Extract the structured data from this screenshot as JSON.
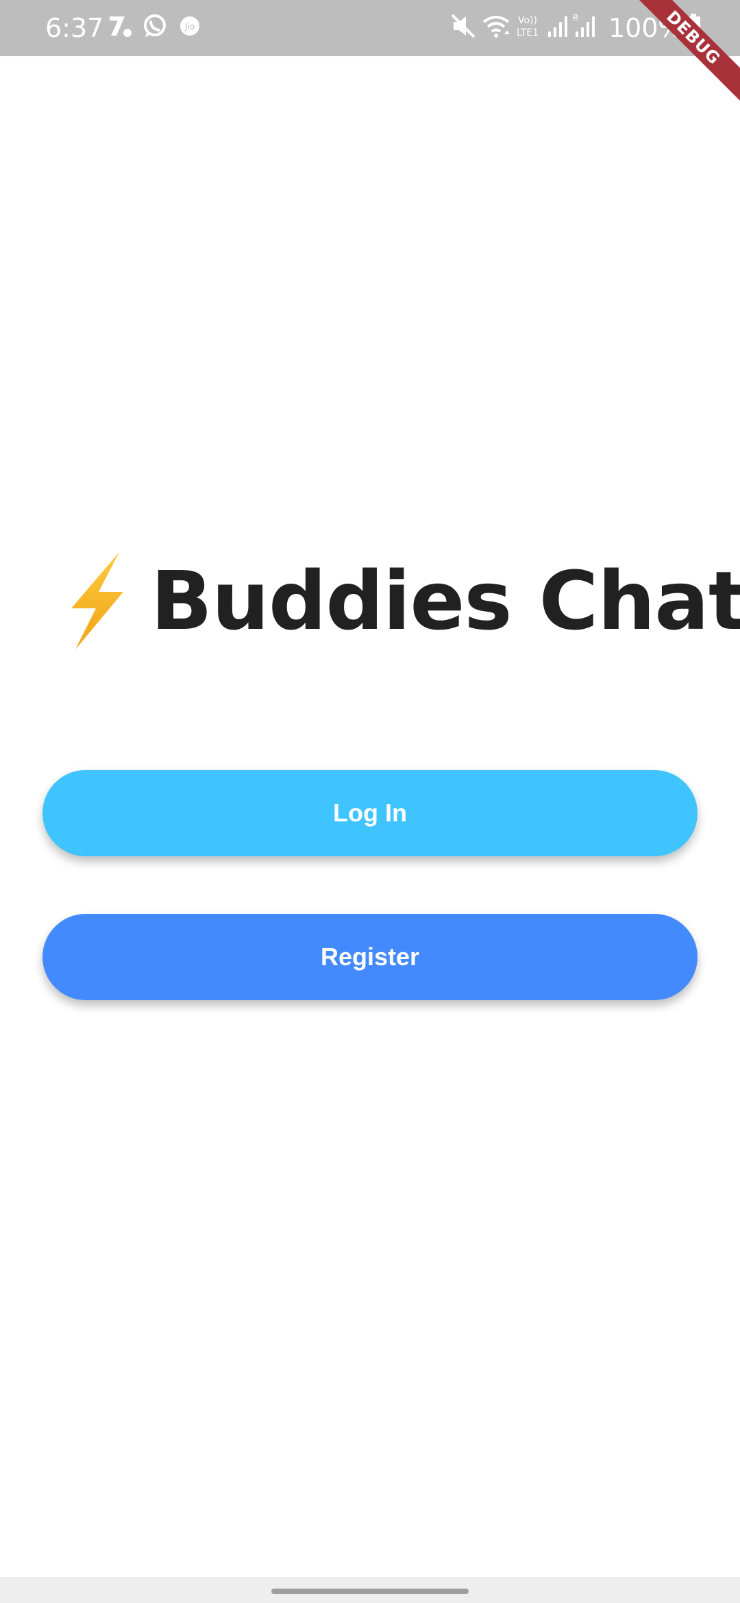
{
  "status_bar": {
    "time": "6:37",
    "battery": "100%",
    "left_icons": [
      "notification-app-icon",
      "whatsapp-icon",
      "jio-icon"
    ],
    "right_icons": [
      "mute-icon",
      "wifi-icon",
      "volte-icon",
      "signal-icon",
      "signal-roaming-icon",
      "battery-icon"
    ]
  },
  "debug_banner": "DEBUG",
  "app": {
    "title": "Buddies Chat",
    "logo_icon": "lightning-bolt-icon"
  },
  "buttons": {
    "login_label": "Log In",
    "register_label": "Register"
  },
  "colors": {
    "login_button": "#40C4FF",
    "register_button": "#448AFF",
    "title_text": "#212121",
    "bolt": "#F5B71F",
    "status_bar": "#BDBDBD"
  }
}
